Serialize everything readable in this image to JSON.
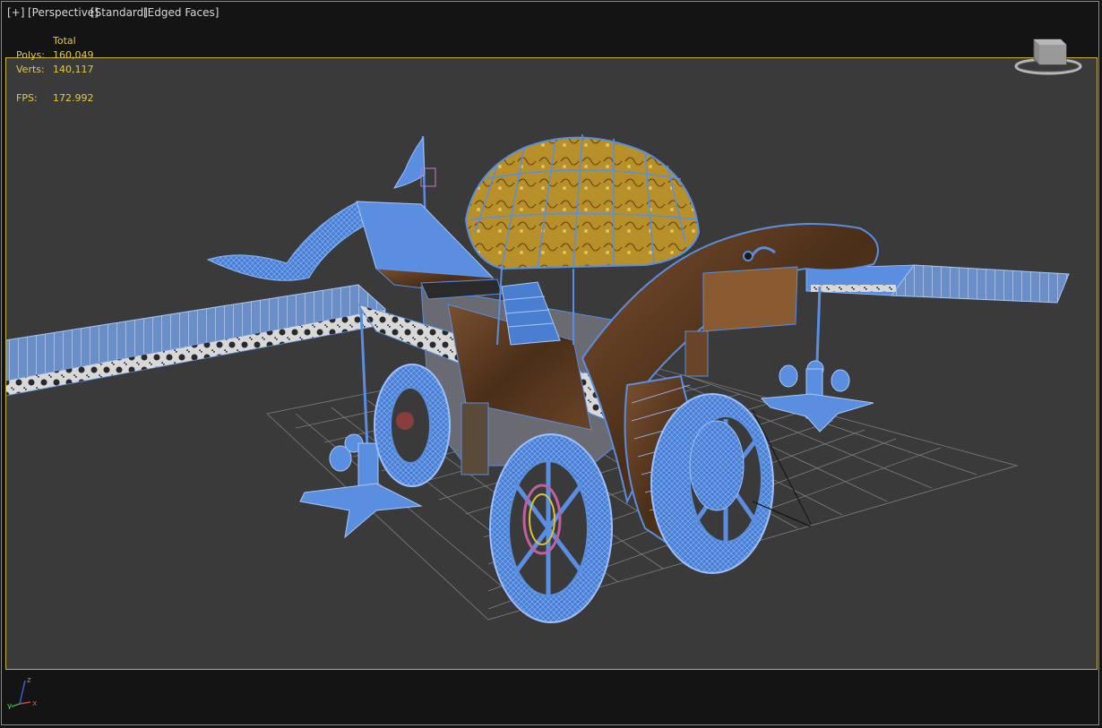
{
  "viewport": {
    "menu": {
      "plus": "[+]",
      "view": "[Perspective]",
      "shading": "[Standard]",
      "edged": "[Edged Faces]"
    },
    "stats": {
      "header": "Total",
      "polys_label": "Polys:",
      "polys_value": "160,049",
      "verts_label": "Verts:",
      "verts_value": "140,117",
      "fps_label": "FPS:",
      "fps_value": "172.992"
    },
    "axis": {
      "x": "x",
      "y": "y",
      "z": "z"
    }
  },
  "colors": {
    "background": "#3a3a3a",
    "letterbox": "#141414",
    "safe_frame": "#c8b23a",
    "wire": "#5a8ee0",
    "wire_light": "#7aaaf0",
    "wood": "#5a3a22",
    "dome_gold": "#b8902a",
    "stats_text": "#e2c84c",
    "grid": "#8a8a8a"
  }
}
